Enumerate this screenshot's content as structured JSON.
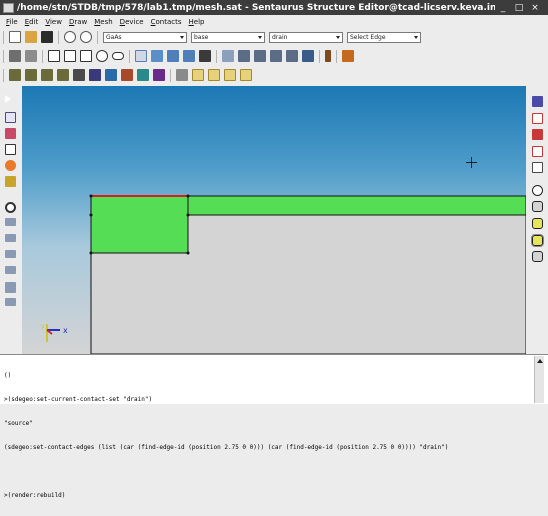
{
  "window": {
    "title": "/home/stn/STDB/tmp/578/lab1.tmp/mesh.sat - Sentaurus Structure Editor@tcad-licserv.keva.int F·",
    "minimize": "_",
    "maximize": "□",
    "close": "×"
  },
  "menu": [
    "File",
    "Edit",
    "View",
    "Draw",
    "Mesh",
    "Device",
    "Contacts",
    "Help"
  ],
  "toolbar": {
    "material": "GaAs",
    "region": "base",
    "contact": "drain",
    "selection": "Select Edge"
  },
  "viewport": {
    "axes": {
      "y": "y",
      "x": "x"
    }
  },
  "console": {
    "lines": [
      "()",
      ">(sdegeo:set-current-contact-set \"drain\")",
      "\"source\"",
      "(sdegeo:set-contact-edges (list (car (find-edge-id (position 2.75 0 0))) (car (find-edge-id (position 2.75 0 0)))) \"drain\")",
      "",
      ">(render:rebuild)"
    ]
  }
}
